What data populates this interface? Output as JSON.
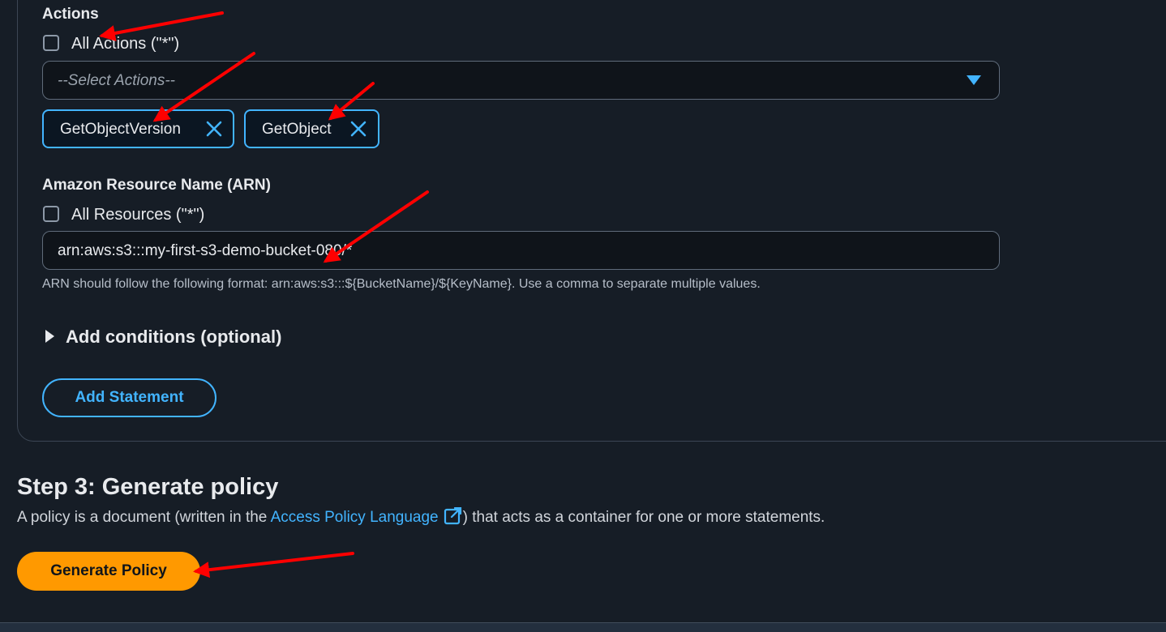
{
  "actions": {
    "section_label": "Actions",
    "all_actions_label": "All Actions (\"*\")",
    "all_actions_checked": false,
    "select_placeholder": "--Select Actions--",
    "selected_tokens": [
      "GetObjectVersion",
      "GetObject"
    ]
  },
  "arn": {
    "section_label": "Amazon Resource Name (ARN)",
    "all_resources_label": "All Resources (\"*\")",
    "all_resources_checked": false,
    "value": "arn:aws:s3:::my-first-s3-demo-bucket-080/*",
    "hint": "ARN should follow the following format: arn:aws:s3:::${BucketName}/${KeyName}. Use a comma to separate multiple values."
  },
  "conditions": {
    "label": "Add conditions (optional)"
  },
  "add_statement_label": "Add Statement",
  "step3": {
    "title": "Step 3: Generate policy",
    "desc_before": "A policy is a document (written in the ",
    "link_text": "Access Policy Language",
    "desc_after": ") that acts as a container for one or more statements.",
    "generate_label": "Generate Policy"
  },
  "icons": {
    "caret": "caret-down-icon",
    "remove": "close-icon",
    "expand": "triangle-right-icon",
    "external": "external-link-icon"
  },
  "colors": {
    "background": "#161d26",
    "accent": "#42b4ff",
    "primary_button": "#ff9900",
    "annotation_arrow": "#ff0000"
  }
}
